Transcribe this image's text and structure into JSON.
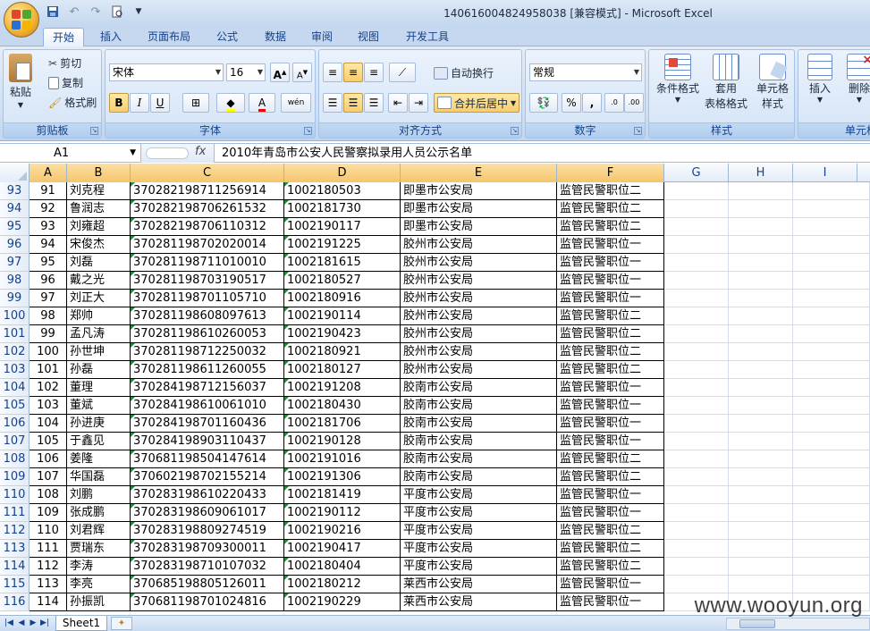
{
  "window": {
    "title": "140616004824958038  [兼容模式] - Microsoft Excel"
  },
  "quick_access": {
    "icons": [
      "save-icon",
      "undo-icon",
      "redo-icon",
      "print-preview-icon",
      "customize-qat-icon"
    ]
  },
  "ribbon": {
    "tabs": [
      "开始",
      "插入",
      "页面布局",
      "公式",
      "数据",
      "审阅",
      "视图",
      "开发工具"
    ],
    "active_tab": "开始",
    "clipboard": {
      "paste": "粘贴",
      "cut": "剪切",
      "copy": "复制",
      "format_painter": "格式刷",
      "label": "剪贴板"
    },
    "font": {
      "name": "宋体",
      "size": "16",
      "bold": "B",
      "italic": "I",
      "underline": "U",
      "phonetic": "wén",
      "label": "字体"
    },
    "alignment": {
      "wrap": "自动换行",
      "merge": "合并后居中",
      "label": "对齐方式"
    },
    "number": {
      "format": "常规",
      "percent": "%",
      "comma": ",",
      "label": "数字"
    },
    "styles": {
      "conditional": "条件格式",
      "table1": "套用",
      "table2": "表格格式",
      "cell1": "单元格",
      "cell2": "样式",
      "label": "样式"
    },
    "cells": {
      "insert": "插入",
      "delete": "删除",
      "label": "单元格"
    }
  },
  "formula_bar": {
    "name_box": "A1",
    "fx": "fx",
    "content": "2010年青岛市公安人民警察拟录用人员公示名单"
  },
  "columns": [
    "A",
    "B",
    "C",
    "D",
    "E",
    "F",
    "G",
    "H",
    "I"
  ],
  "rows": [
    {
      "r": "93",
      "a": "91",
      "b": "刘克程",
      "c": "370282198711256914",
      "d": "1002180503",
      "e": "即墨市公安局",
      "f": "监管民警职位二"
    },
    {
      "r": "94",
      "a": "92",
      "b": "鲁润志",
      "c": "370282198706261532",
      "d": "1002181730",
      "e": "即墨市公安局",
      "f": "监管民警职位二"
    },
    {
      "r": "95",
      "a": "93",
      "b": "刘雍超",
      "c": "370282198706110312",
      "d": "1002190117",
      "e": "即墨市公安局",
      "f": "监管民警职位二"
    },
    {
      "r": "96",
      "a": "94",
      "b": "宋俊杰",
      "c": "370281198702020014",
      "d": "1002191225",
      "e": "胶州市公安局",
      "f": "监管民警职位一"
    },
    {
      "r": "97",
      "a": "95",
      "b": "刘磊",
      "c": "370281198711010010",
      "d": "1002181615",
      "e": "胶州市公安局",
      "f": "监管民警职位一"
    },
    {
      "r": "98",
      "a": "96",
      "b": "戴之光",
      "c": "370281198703190517",
      "d": "1002180527",
      "e": "胶州市公安局",
      "f": "监管民警职位一"
    },
    {
      "r": "99",
      "a": "97",
      "b": "刘正大",
      "c": "370281198701105710",
      "d": "1002180916",
      "e": "胶州市公安局",
      "f": "监管民警职位一"
    },
    {
      "r": "100",
      "a": "98",
      "b": "郑帅",
      "c": "370281198608097613",
      "d": "1002190114",
      "e": "胶州市公安局",
      "f": "监管民警职位二"
    },
    {
      "r": "101",
      "a": "99",
      "b": "孟凡涛",
      "c": "370281198610260053",
      "d": "1002190423",
      "e": "胶州市公安局",
      "f": "监管民警职位二"
    },
    {
      "r": "102",
      "a": "100",
      "b": "孙世坤",
      "c": "370281198712250032",
      "d": "1002180921",
      "e": "胶州市公安局",
      "f": "监管民警职位二"
    },
    {
      "r": "103",
      "a": "101",
      "b": "孙磊",
      "c": "370281198611260055",
      "d": "1002180127",
      "e": "胶州市公安局",
      "f": "监管民警职位二"
    },
    {
      "r": "104",
      "a": "102",
      "b": "董理",
      "c": "370284198712156037",
      "d": "1002191208",
      "e": "胶南市公安局",
      "f": "监管民警职位一"
    },
    {
      "r": "105",
      "a": "103",
      "b": "董斌",
      "c": "370284198610061010",
      "d": "1002180430",
      "e": "胶南市公安局",
      "f": "监管民警职位一"
    },
    {
      "r": "106",
      "a": "104",
      "b": "孙进庚",
      "c": "370284198701160436",
      "d": "1002181706",
      "e": "胶南市公安局",
      "f": "监管民警职位一"
    },
    {
      "r": "107",
      "a": "105",
      "b": "于鑫见",
      "c": "370284198903110437",
      "d": "1002190128",
      "e": "胶南市公安局",
      "f": "监管民警职位一"
    },
    {
      "r": "108",
      "a": "106",
      "b": "姜隆",
      "c": "370681198504147614",
      "d": "1002191016",
      "e": "胶南市公安局",
      "f": "监管民警职位二"
    },
    {
      "r": "109",
      "a": "107",
      "b": "华国磊",
      "c": "370602198702155214",
      "d": "1002191306",
      "e": "胶南市公安局",
      "f": "监管民警职位二"
    },
    {
      "r": "110",
      "a": "108",
      "b": "刘鹏",
      "c": "370283198610220433",
      "d": "1002181419",
      "e": "平度市公安局",
      "f": "监管民警职位一"
    },
    {
      "r": "111",
      "a": "109",
      "b": "张成鹏",
      "c": "370283198609061017",
      "d": "1002190112",
      "e": "平度市公安局",
      "f": "监管民警职位一"
    },
    {
      "r": "112",
      "a": "110",
      "b": "刘君辉",
      "c": "370283198809274519",
      "d": "1002190216",
      "e": "平度市公安局",
      "f": "监管民警职位二"
    },
    {
      "r": "113",
      "a": "111",
      "b": "贾瑞东",
      "c": "370283198709300011",
      "d": "1002190417",
      "e": "平度市公安局",
      "f": "监管民警职位二"
    },
    {
      "r": "114",
      "a": "112",
      "b": "李涛",
      "c": "370283198710107032",
      "d": "1002180404",
      "e": "平度市公安局",
      "f": "监管民警职位二"
    },
    {
      "r": "115",
      "a": "113",
      "b": "李亮",
      "c": "370685198805126011",
      "d": "1002180212",
      "e": "莱西市公安局",
      "f": "监管民警职位一"
    },
    {
      "r": "116",
      "a": "114",
      "b": "孙振凯",
      "c": "370681198701024816",
      "d": "1002190229",
      "e": "莱西市公安局",
      "f": "监管民警职位一"
    }
  ],
  "sheets": [
    "Sheet1"
  ],
  "watermark": "www.wooyun.org"
}
